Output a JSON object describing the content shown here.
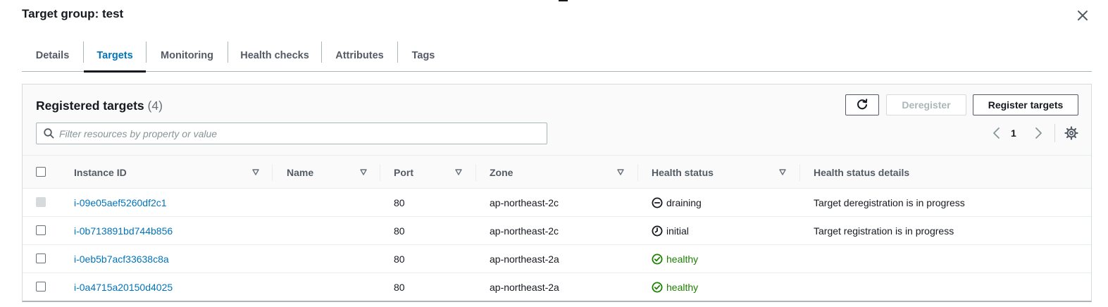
{
  "title": "Target group: test",
  "tabs": [
    {
      "label": "Details"
    },
    {
      "label": "Targets"
    },
    {
      "label": "Monitoring"
    },
    {
      "label": "Health checks"
    },
    {
      "label": "Attributes"
    },
    {
      "label": "Tags"
    }
  ],
  "active_tab": "Targets",
  "panel": {
    "title": "Registered targets",
    "count": "(4)",
    "refresh_icon": "refresh-icon",
    "deregister_label": "Deregister",
    "register_label": "Register targets",
    "search_placeholder": "Filter resources by property or value",
    "search_value": "",
    "page": "1"
  },
  "columns": [
    {
      "label": "Instance ID"
    },
    {
      "label": "Name"
    },
    {
      "label": "Port"
    },
    {
      "label": "Zone"
    },
    {
      "label": "Health status"
    },
    {
      "label": "Health status details"
    }
  ],
  "rows": [
    {
      "instance_id": "i-09e05aef5260df2c1",
      "name": "",
      "port": "80",
      "zone": "ap-northeast-2c",
      "status": "draining",
      "status_icon": "minus-circle-icon",
      "details": "Target deregistration is in progress",
      "checkbox_disabled": true
    },
    {
      "instance_id": "i-0b713891bd744b856",
      "name": "",
      "port": "80",
      "zone": "ap-northeast-2c",
      "status": "initial",
      "status_icon": "clock-icon",
      "details": "Target registration is in progress",
      "checkbox_disabled": false
    },
    {
      "instance_id": "i-0eb5b7acf33638c8a",
      "name": "",
      "port": "80",
      "zone": "ap-northeast-2a",
      "status": "healthy",
      "status_icon": "check-circle-icon",
      "details": "",
      "checkbox_disabled": false
    },
    {
      "instance_id": "i-0a4715a20150d4025",
      "name": "",
      "port": "80",
      "zone": "ap-northeast-2a",
      "status": "healthy",
      "status_icon": "check-circle-icon",
      "details": "",
      "checkbox_disabled": false
    }
  ],
  "colors": {
    "link": "#0073bb",
    "healthy": "#1d8102",
    "text": "#16191f",
    "muted": "#545b64",
    "disabled": "#aab7b8"
  }
}
